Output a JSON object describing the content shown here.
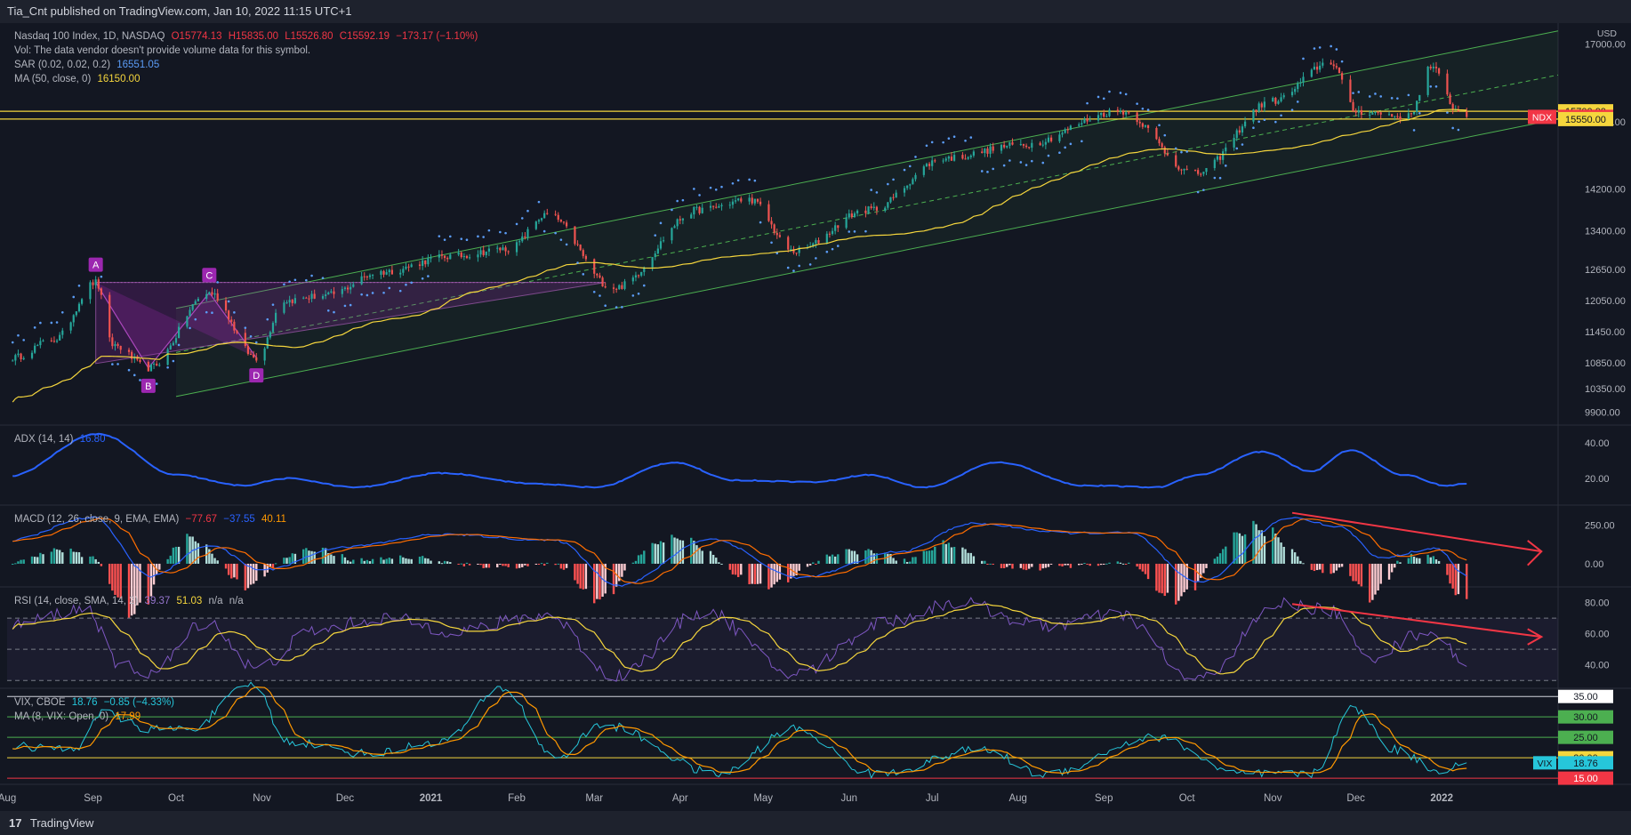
{
  "header": {
    "text": "Tia_Cnt published on TradingView.com, Jan 10, 2022 11:15 UTC+1"
  },
  "footer": {
    "brand": "TradingView",
    "logo": "17"
  },
  "currency": "USD",
  "legend": {
    "main": {
      "title": "Nasdaq 100 Index, 1D, NASDAQ",
      "o": "O15774.13",
      "h": "H15835.00",
      "l": "L15526.80",
      "c": "C15592.19",
      "chg": "−173.17 (−1.10%)"
    },
    "vol": "Vol: The data vendor doesn't provide volume data for this symbol.",
    "sar": {
      "label": "SAR (0.02, 0.02, 0.2)",
      "value": "16551.05"
    },
    "ma": {
      "label": "MA (50, close, 0)",
      "value": "16150.00"
    },
    "adx": {
      "label": "ADX (14, 14)",
      "value": "16.80"
    },
    "macd": {
      "label": "MACD (12, 26, close, 9, EMA, EMA)",
      "v1": "−77.67",
      "v2": "−37.55",
      "v3": "40.11"
    },
    "rsi": {
      "label": "RSI (14, close, SMA, 14, 2)",
      "v1": "39.37",
      "v2": "51.03",
      "v3": "n/a",
      "v4": "n/a"
    },
    "vix": {
      "label": "VIX, CBOE",
      "value": "18.76",
      "chg": "−0.85 (−4.33%)"
    },
    "vixma": {
      "label": "MA (8, VIX: Open, 0)",
      "value": "17.99"
    }
  },
  "colors": {
    "bg": "#131722",
    "up": "#26a69a",
    "down": "#ef5350",
    "sar": "#5b9cf6",
    "ma": "#f5d63d",
    "channel": "#4caf50",
    "harmonic": "#9c27b0",
    "adx": "#2962ff",
    "macd": "#2962ff",
    "signal": "#ff6d00",
    "rsi": "#7e57c2",
    "rsima": "#f5d63d",
    "vix": "#26c6da",
    "vixma": "#ff9800",
    "arrow": "#f23645"
  },
  "chart_data": [
    {
      "type": "candlestick",
      "name": "price",
      "symbol": "NDX",
      "xlim": [
        "2020-08-01",
        "2022-02-12"
      ],
      "ylim": [
        9650,
        17400
      ],
      "y_ticks": [
        "17000.00",
        "15500.00",
        "14200.00",
        "13400.00",
        "12650.00",
        "12050.00",
        "11450.00",
        "10850.00",
        "10350.00",
        "9900.00"
      ],
      "y_tick_values": [
        17000,
        15500,
        14200,
        13400,
        12650,
        12050,
        11450,
        10850,
        10350,
        9900
      ],
      "price_labels": [
        {
          "text": "15700.00",
          "value": 15700,
          "color": "#f5d63d"
        },
        {
          "text": "15592.19",
          "value": 15592.19,
          "color": "#f23645",
          "tag": "NDX"
        },
        {
          "text": "15550.00",
          "value": 15550,
          "color": "#f5d63d"
        }
      ],
      "horizontal_levels": [
        15700,
        15550
      ],
      "path_anchors": [
        [
          "2020-08-03",
          10950
        ],
        [
          "2020-08-18",
          11300
        ],
        [
          "2020-09-02",
          12400
        ],
        [
          "2020-09-08",
          11200
        ],
        [
          "2020-09-21",
          10750
        ],
        [
          "2020-10-13",
          12200
        ],
        [
          "2020-10-30",
          10950
        ],
        [
          "2020-11-09",
          12050
        ],
        [
          "2020-11-24",
          12150
        ],
        [
          "2020-12-14",
          12600
        ],
        [
          "2021-01-08",
          12900
        ],
        [
          "2021-01-29",
          13050
        ],
        [
          "2021-02-12",
          13700
        ],
        [
          "2021-03-08",
          12300
        ],
        [
          "2021-04-08",
          13800
        ],
        [
          "2021-04-26",
          14000
        ],
        [
          "2021-05-12",
          13000
        ],
        [
          "2021-06-08",
          13800
        ],
        [
          "2021-07-06",
          14800
        ],
        [
          "2021-08-02",
          15050
        ],
        [
          "2021-09-07",
          15700
        ],
        [
          "2021-10-04",
          14500
        ],
        [
          "2021-11-01",
          15900
        ],
        [
          "2021-11-22",
          16650
        ],
        [
          "2021-12-01",
          15700
        ],
        [
          "2021-12-20",
          15600
        ],
        [
          "2021-12-28",
          16550
        ],
        [
          "2022-01-07",
          15700
        ],
        [
          "2022-01-10",
          15592
        ]
      ],
      "annotations": {
        "channel": {
          "start": [
            "2020-10-01",
            11900
          ],
          "end": [
            "2022-02-12",
            17250
          ],
          "lower_offset": -1700
        },
        "harmonic_points": [
          {
            "label": "A",
            "x": "2020-09-02",
            "y": 12400
          },
          {
            "label": "B",
            "x": "2020-09-21",
            "y": 10750
          },
          {
            "label": "C",
            "x": "2020-10-13",
            "y": 12200
          },
          {
            "label": "D",
            "x": "2020-10-30",
            "y": 10950
          }
        ]
      }
    },
    {
      "type": "line",
      "name": "ADX (14, 14)",
      "ylim": [
        5,
        50
      ],
      "y_ticks": [
        "40.00",
        "20.00"
      ],
      "y_tick_values": [
        40,
        20
      ],
      "anchors": [
        [
          "2020-08-01",
          21
        ],
        [
          "2020-09-03",
          45
        ],
        [
          "2020-10-01",
          22
        ],
        [
          "2020-10-25",
          16
        ],
        [
          "2020-11-10",
          20
        ],
        [
          "2020-12-05",
          15
        ],
        [
          "2021-01-05",
          23
        ],
        [
          "2021-02-08",
          17
        ],
        [
          "2021-03-01",
          15
        ],
        [
          "2021-03-30",
          29
        ],
        [
          "2021-04-20",
          19
        ],
        [
          "2021-05-20",
          18
        ],
        [
          "2021-06-08",
          22
        ],
        [
          "2021-06-28",
          15
        ],
        [
          "2021-07-25",
          29
        ],
        [
          "2021-08-25",
          16
        ],
        [
          "2021-09-20",
          15
        ],
        [
          "2021-10-05",
          22
        ],
        [
          "2021-10-28",
          35
        ],
        [
          "2021-11-15",
          24
        ],
        [
          "2021-11-29",
          36
        ],
        [
          "2021-12-18",
          22
        ],
        [
          "2022-01-03",
          16
        ],
        [
          "2022-01-10",
          17
        ]
      ]
    },
    {
      "type": "line",
      "name": "MACD (12, 26, close, 9, EMA, EMA)",
      "ylim": [
        -150,
        380
      ],
      "y_ticks": [
        "250.00",
        "0.00"
      ],
      "y_tick_values": [
        250,
        0
      ],
      "anchors": [
        [
          "2020-08-01",
          150
        ],
        [
          "2020-09-01",
          300
        ],
        [
          "2020-09-22",
          -80
        ],
        [
          "2020-10-13",
          120
        ],
        [
          "2020-11-01",
          -40
        ],
        [
          "2020-12-01",
          110
        ],
        [
          "2021-01-05",
          190
        ],
        [
          "2021-02-15",
          150
        ],
        [
          "2021-03-10",
          -140
        ],
        [
          "2021-04-12",
          160
        ],
        [
          "2021-05-14",
          -90
        ],
        [
          "2021-06-20",
          80
        ],
        [
          "2021-07-15",
          260
        ],
        [
          "2021-08-20",
          200
        ],
        [
          "2021-09-10",
          200
        ],
        [
          "2021-10-05",
          -120
        ],
        [
          "2021-11-08",
          300
        ],
        [
          "2021-11-25",
          240
        ],
        [
          "2021-12-10",
          40
        ],
        [
          "2021-12-30",
          100
        ],
        [
          "2022-01-10",
          -80
        ]
      ]
    },
    {
      "type": "line",
      "name": "RSI (14, close, SMA, 14, 2)",
      "ylim": [
        25,
        90
      ],
      "y_ticks": [
        "80.00",
        "60.00",
        "40.00"
      ],
      "y_tick_values": [
        80,
        60,
        40
      ],
      "bands": [
        70,
        50,
        30
      ],
      "anchors": [
        [
          "2020-08-01",
          65
        ],
        [
          "2020-08-30",
          76
        ],
        [
          "2020-09-10",
          40
        ],
        [
          "2020-09-22",
          35
        ],
        [
          "2020-10-12",
          68
        ],
        [
          "2020-10-30",
          38
        ],
        [
          "2020-11-20",
          62
        ],
        [
          "2020-12-15",
          70
        ],
        [
          "2021-01-10",
          62
        ],
        [
          "2021-02-12",
          72
        ],
        [
          "2021-03-08",
          33
        ],
        [
          "2021-04-10",
          74
        ],
        [
          "2021-05-12",
          34
        ],
        [
          "2021-06-15",
          68
        ],
        [
          "2021-07-10",
          80
        ],
        [
          "2021-08-10",
          65
        ],
        [
          "2021-09-07",
          72
        ],
        [
          "2021-10-04",
          30
        ],
        [
          "2021-11-05",
          79
        ],
        [
          "2021-11-22",
          75
        ],
        [
          "2021-12-05",
          45
        ],
        [
          "2021-12-28",
          62
        ],
        [
          "2022-01-10",
          39
        ]
      ]
    },
    {
      "type": "line",
      "name": "VIX, CBOE",
      "ylim": [
        13.5,
        37
      ],
      "y_ticks": [
        "35.00",
        "30.00",
        "25.00",
        "20.00",
        "15.00"
      ],
      "y_tick_values": [
        35,
        30,
        25,
        20,
        15
      ],
      "levels": [
        {
          "value": 30,
          "color": "#4caf50"
        },
        {
          "value": 25,
          "color": "#4caf50"
        },
        {
          "value": 20,
          "color": "#f5d63d"
        },
        {
          "value": 15,
          "color": "#f23645"
        }
      ],
      "last_label": {
        "text": "18.76",
        "tag": "VIX",
        "value": 18.76
      },
      "anchors": [
        [
          "2020-08-01",
          23
        ],
        [
          "2020-08-25",
          22
        ],
        [
          "2020-09-04",
          31
        ],
        [
          "2020-09-22",
          27
        ],
        [
          "2020-10-05",
          27
        ],
        [
          "2020-10-29",
          38
        ],
        [
          "2020-11-10",
          24
        ],
        [
          "2020-12-10",
          21
        ],
        [
          "2021-01-05",
          24
        ],
        [
          "2021-01-27",
          37
        ],
        [
          "2021-02-15",
          20
        ],
        [
          "2021-03-04",
          28
        ],
        [
          "2021-04-15",
          16
        ],
        [
          "2021-05-12",
          27
        ],
        [
          "2021-06-10",
          16
        ],
        [
          "2021-07-19",
          22
        ],
        [
          "2021-08-10",
          16
        ],
        [
          "2021-09-20",
          25
        ],
        [
          "2021-10-20",
          16
        ],
        [
          "2021-11-15",
          16
        ],
        [
          "2021-11-30",
          32
        ],
        [
          "2021-12-15",
          22
        ],
        [
          "2021-12-31",
          17
        ],
        [
          "2022-01-10",
          18.76
        ]
      ]
    }
  ],
  "x_axis": {
    "labels": [
      {
        "text": "Aug",
        "date": "2020-08-01"
      },
      {
        "text": "Sep",
        "date": "2020-09-01"
      },
      {
        "text": "Oct",
        "date": "2020-10-01"
      },
      {
        "text": "Nov",
        "date": "2020-11-01"
      },
      {
        "text": "Dec",
        "date": "2020-12-01"
      },
      {
        "text": "2021",
        "date": "2021-01-01"
      },
      {
        "text": "Feb",
        "date": "2021-02-01"
      },
      {
        "text": "Mar",
        "date": "2021-03-01"
      },
      {
        "text": "Apr",
        "date": "2021-04-01"
      },
      {
        "text": "May",
        "date": "2021-05-01"
      },
      {
        "text": "Jun",
        "date": "2021-06-01"
      },
      {
        "text": "Jul",
        "date": "2021-07-01"
      },
      {
        "text": "Aug",
        "date": "2021-08-01"
      },
      {
        "text": "Sep",
        "date": "2021-09-01"
      },
      {
        "text": "Oct",
        "date": "2021-10-01"
      },
      {
        "text": "Nov",
        "date": "2021-11-01"
      },
      {
        "text": "Dec",
        "date": "2021-12-01"
      },
      {
        "text": "2022",
        "date": "2022-01-01"
      }
    ]
  }
}
